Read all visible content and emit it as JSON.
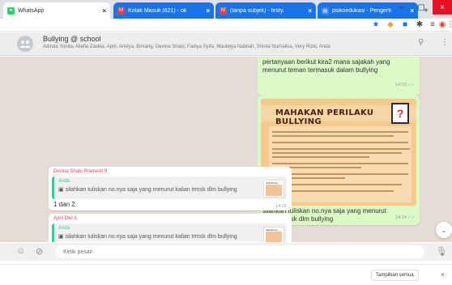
{
  "browser": {
    "tabs": [
      {
        "label": "WhatsApp",
        "active": true,
        "favicon": "whatsapp-icon"
      },
      {
        "label": "Kotak Masuk (621) - ok",
        "active": false,
        "favicon": "gmail-icon"
      },
      {
        "label": "(tanpa subjek) - firsty.",
        "active": false,
        "favicon": "gmail-icon"
      },
      {
        "label": "psikoedukasi - Pengerti",
        "active": false,
        "favicon": "docs-icon"
      }
    ],
    "new_tab": "+",
    "colors": {
      "tab_inactive": "#1a73e8",
      "tabstrip": "#dee1e6"
    }
  },
  "chat": {
    "group_name": "Bullying @ school",
    "members": "Adinda Yunita, Aliefia Zaskia, April, Aristya, Bintang, Devina Shabi, Fadiya Syifa, Maulidya Nabilah, Shinta Nurhalisa, Very Rizki, Anda",
    "messages": {
      "out1": {
        "text": "pertanyaan berikut kira2 mana sajakah yang menurut teman termasuk dalam bullying",
        "time": "14:13",
        "ticks": "✓✓"
      },
      "out2": {
        "poster_title": "MAHAKAN PERILAKU BULLYING",
        "poster_mark": "?",
        "text": "silahkan tuliskan no.nya saja yang menurut kalian trmsk dlm bullying",
        "time": "14:14",
        "ticks": "✓✓"
      },
      "in1": {
        "sender": "Devina Shabi Pramesti 9",
        "quote_sender": "Anda",
        "quote_text": "silahkan tuliskan no.nya saja yang menurut kalian trmsk dlm bullying",
        "thumb_title": "MAHAKAN PERILAKU",
        "text": "1 dan 2",
        "time": "14:15"
      },
      "in2": {
        "sender": "April Dwi A.",
        "quote_sender": "Anda",
        "quote_text": "silahkan tuliskan no.nya saja yang menurut kalian trmsk dlm bullying",
        "thumb_title": "MAHAKAN PERILAKU"
      }
    },
    "colors": {
      "background": "#e5ddd5",
      "outgoing": "#dcf8c6",
      "sender": "#e5455e",
      "quote_accent": "#35cd96"
    }
  },
  "composer": {
    "placeholder": "Ketik pesan"
  },
  "downloads": {
    "show_all": "Tampilkan semua"
  }
}
